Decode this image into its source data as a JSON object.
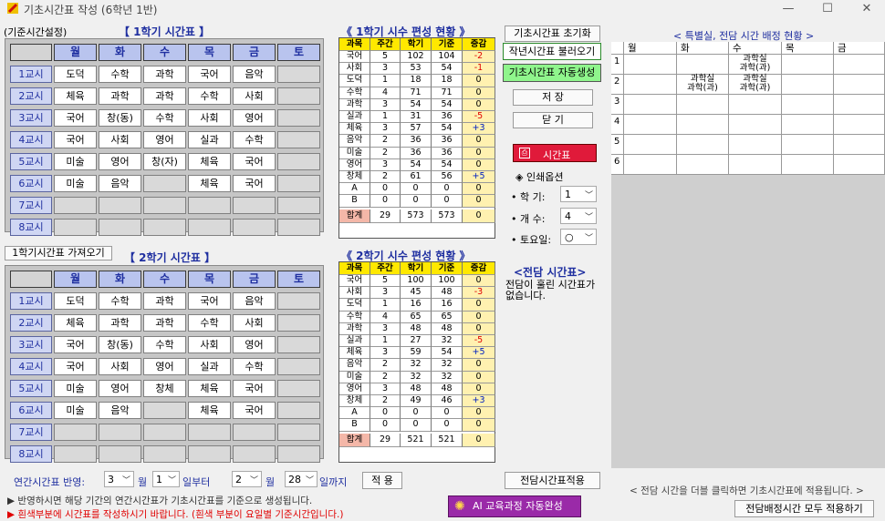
{
  "window": {
    "title": "기초시간표 작성 (6학년 1반)",
    "min": "—",
    "max": "☐",
    "close": "✕"
  },
  "top": {
    "basis_label": "(기준시간설정)",
    "reset_btn": "기초시간표 초기화",
    "prev_year_btn": "작년시간표 불러오기",
    "auto_btn": "기초시간표 자동생성",
    "save_btn": "저 장",
    "close_btn": "닫 기",
    "timetable_btn": "시간표",
    "print_options": "◈ 인쇄옵션",
    "sem_label": "• 학 기:",
    "sem_val": "1",
    "count_label": "• 개 수:",
    "count_val": "4",
    "sat_label": "• 토요일:",
    "sat_val": "○"
  },
  "sem1": {
    "title": "【 1학기 시간표 】",
    "days": [
      "월",
      "화",
      "수",
      "목",
      "금",
      "토"
    ],
    "periods": [
      "1교시",
      "2교시",
      "3교시",
      "4교시",
      "5교시",
      "6교시",
      "7교시",
      "8교시"
    ],
    "rows": [
      [
        "도덕",
        "수학",
        "과학",
        "국어",
        "음악",
        ""
      ],
      [
        "체육",
        "과학",
        "과학",
        "수학",
        "사회",
        ""
      ],
      [
        "국어",
        "창(동)",
        "수학",
        "사회",
        "영어",
        ""
      ],
      [
        "국어",
        "사회",
        "영어",
        "실과",
        "수학",
        ""
      ],
      [
        "미술",
        "영어",
        "창(자)",
        "체육",
        "국어",
        ""
      ],
      [
        "미술",
        "음악",
        "",
        "체육",
        "국어",
        ""
      ],
      [
        "",
        "",
        "",
        "",
        "",
        ""
      ],
      [
        "",
        "",
        "",
        "",
        "",
        ""
      ]
    ]
  },
  "sem2": {
    "title": "【 2학기 시간표 】",
    "load_btn": "1학기시간표 가져오기",
    "days": [
      "월",
      "화",
      "수",
      "목",
      "금",
      "토"
    ],
    "periods": [
      "1교시",
      "2교시",
      "3교시",
      "4교시",
      "5교시",
      "6교시",
      "7교시",
      "8교시"
    ],
    "rows": [
      [
        "도덕",
        "수학",
        "과학",
        "국어",
        "음악",
        ""
      ],
      [
        "체육",
        "과학",
        "과학",
        "수학",
        "사회",
        ""
      ],
      [
        "국어",
        "창(동)",
        "수학",
        "사회",
        "영어",
        ""
      ],
      [
        "국어",
        "사회",
        "영어",
        "실과",
        "수학",
        ""
      ],
      [
        "미술",
        "영어",
        "창체",
        "체육",
        "국어",
        ""
      ],
      [
        "미술",
        "음악",
        "",
        "체육",
        "국어",
        ""
      ],
      [
        "",
        "",
        "",
        "",
        "",
        ""
      ],
      [
        "",
        "",
        "",
        "",
        "",
        ""
      ]
    ]
  },
  "stat1": {
    "title": "《 1학기 시수 편성 현황 》",
    "headers": [
      "과목",
      "주간",
      "학기",
      "기준",
      "증감"
    ],
    "rows": [
      [
        "국어",
        "5",
        "102",
        "104",
        "-2"
      ],
      [
        "사회",
        "3",
        "53",
        "54",
        "-1"
      ],
      [
        "도덕",
        "1",
        "18",
        "18",
        "0"
      ],
      [
        "수학",
        "4",
        "71",
        "71",
        "0"
      ],
      [
        "과학",
        "3",
        "54",
        "54",
        "0"
      ],
      [
        "실과",
        "1",
        "31",
        "36",
        "-5"
      ],
      [
        "체육",
        "3",
        "57",
        "54",
        "+3"
      ],
      [
        "음악",
        "2",
        "36",
        "36",
        "0"
      ],
      [
        "미술",
        "2",
        "36",
        "36",
        "0"
      ],
      [
        "영어",
        "3",
        "54",
        "54",
        "0"
      ],
      [
        "창체",
        "2",
        "61",
        "56",
        "+5"
      ],
      [
        "A",
        "0",
        "0",
        "0",
        "0"
      ],
      [
        "B",
        "0",
        "0",
        "0",
        "0"
      ]
    ],
    "total": [
      "합계",
      "29",
      "573",
      "573",
      "0"
    ]
  },
  "stat2": {
    "title": "《 2학기 시수 편성 현황 》",
    "headers": [
      "과목",
      "주간",
      "학기",
      "기준",
      "증감"
    ],
    "rows": [
      [
        "국어",
        "5",
        "100",
        "100",
        "0"
      ],
      [
        "사회",
        "3",
        "45",
        "48",
        "-3"
      ],
      [
        "도덕",
        "1",
        "16",
        "16",
        "0"
      ],
      [
        "수학",
        "4",
        "65",
        "65",
        "0"
      ],
      [
        "과학",
        "3",
        "48",
        "48",
        "0"
      ],
      [
        "실과",
        "1",
        "27",
        "32",
        "-5"
      ],
      [
        "체육",
        "3",
        "59",
        "54",
        "+5"
      ],
      [
        "음악",
        "2",
        "32",
        "32",
        "0"
      ],
      [
        "미술",
        "2",
        "32",
        "32",
        "0"
      ],
      [
        "영어",
        "3",
        "48",
        "48",
        "0"
      ],
      [
        "창체",
        "2",
        "49",
        "46",
        "+3"
      ],
      [
        "A",
        "0",
        "0",
        "0",
        "0"
      ],
      [
        "B",
        "0",
        "0",
        "0",
        "0"
      ]
    ],
    "total": [
      "합계",
      "29",
      "521",
      "521",
      "0"
    ]
  },
  "dedicated": {
    "title": "<전담 시간표>",
    "empty": "전담이 훌린 시간표가 없습니다.",
    "apply_btn": "전담시간표적용"
  },
  "special": {
    "title": "< 특별실, 전담 시간 배정 현황 >",
    "days": [
      "월",
      "화",
      "수",
      "목",
      "금"
    ],
    "rows": [
      "1",
      "2",
      "3",
      "4",
      "5",
      "6"
    ],
    "entries": {
      "r1c3": "과학실\n과학(과)",
      "r2c2": "과학실\n과학(과)",
      "r2c3": "과학실\n과학(과)"
    },
    "hint": "< 전담 시간을 더블 클릭하면 기초시간표에 적용됩니다. >",
    "apply_all_btn": "전담배정시간 모두 적용하기"
  },
  "bottom": {
    "label": "연간시간표 반영:",
    "month1": "3",
    "m1": "월",
    "day1": "1",
    "d1": "일부터",
    "month2": "2",
    "m2": "월",
    "day2": "28",
    "d2": "일까지",
    "apply": "적 용",
    "note1": "▶ 반영하시면 해당 기간의 연간시간표가 기초시간표를 기준으로 생성됩니다.",
    "note2": "▶ 흰색부분에 시간표를 작성하시기 바랍니다. (흰색 부분이 요일별 기준시간입니다.)",
    "ai_btn": "AI 교육과정 자동완성"
  }
}
